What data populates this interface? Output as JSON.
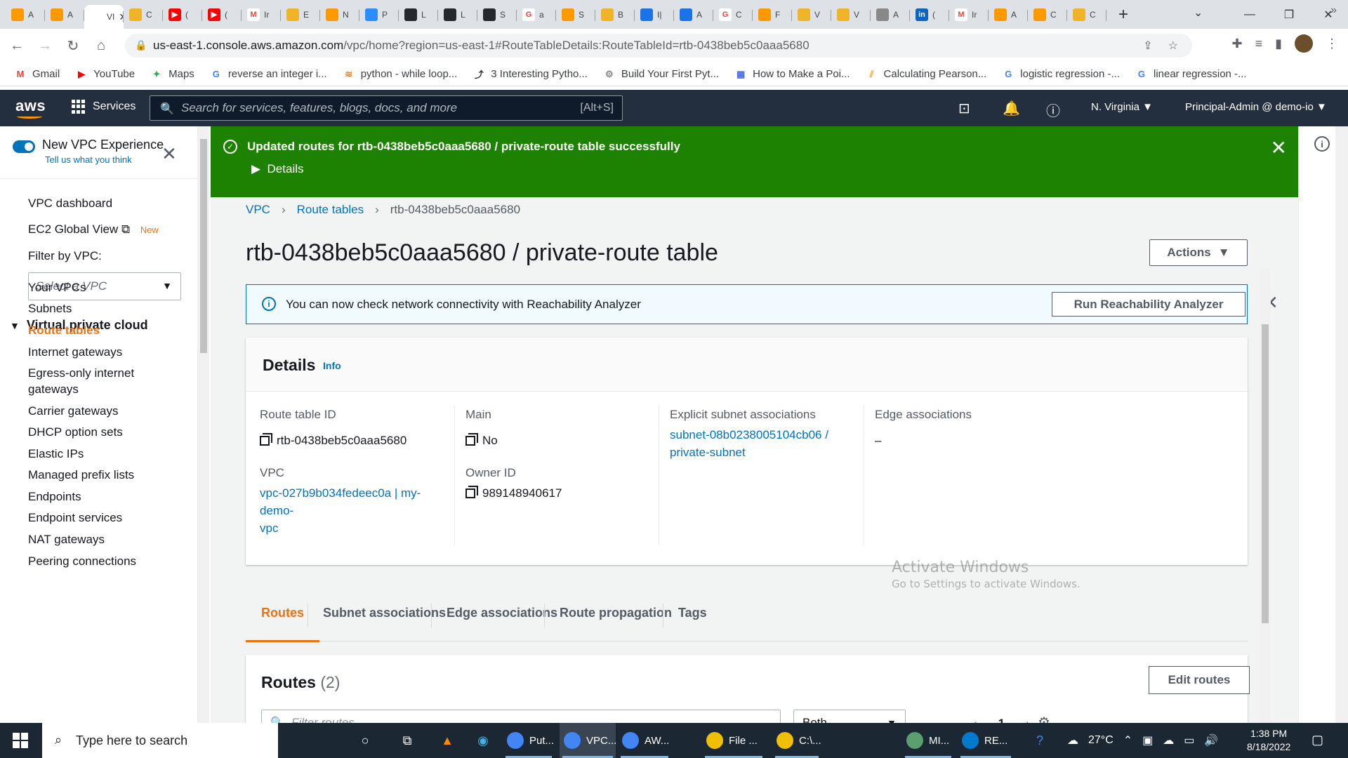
{
  "browser": {
    "tabs": [
      {
        "label": "A",
        "color": "#ff9900",
        "glyph": ""
      },
      {
        "label": "A",
        "color": "#ff9900",
        "glyph": ""
      },
      {
        "label": "VI",
        "color": "#ffffff",
        "glyph": "",
        "active": true
      },
      {
        "label": "C",
        "color": "#f0b429",
        "glyph": ""
      },
      {
        "label": "(",
        "color": "#ff0000",
        "glyph": "▶"
      },
      {
        "label": "(",
        "color": "#ff0000",
        "glyph": "▶"
      },
      {
        "label": "Ir",
        "color": "#ffffff",
        "glyph": "M"
      },
      {
        "label": "E",
        "color": "#f0b429",
        "glyph": ""
      },
      {
        "label": "N",
        "color": "#ff9900",
        "glyph": ""
      },
      {
        "label": "P",
        "color": "#2d8cff",
        "glyph": ""
      },
      {
        "label": "L",
        "color": "#24292e",
        "glyph": ""
      },
      {
        "label": "L",
        "color": "#24292e",
        "glyph": ""
      },
      {
        "label": "S",
        "color": "#24292e",
        "glyph": ""
      },
      {
        "label": "a",
        "color": "#ffffff",
        "glyph": "G"
      },
      {
        "label": "S",
        "color": "#ff9900",
        "glyph": ""
      },
      {
        "label": "B",
        "color": "#f0b429",
        "glyph": ""
      },
      {
        "label": "I|",
        "color": "#1a73e8",
        "glyph": ""
      },
      {
        "label": "A",
        "color": "#1a73e8",
        "glyph": ""
      },
      {
        "label": "C",
        "color": "#ffffff",
        "glyph": "G"
      },
      {
        "label": "F",
        "color": "#ff9900",
        "glyph": ""
      },
      {
        "label": "V",
        "color": "#f0b429",
        "glyph": ""
      },
      {
        "label": "V",
        "color": "#f0b429",
        "glyph": ""
      },
      {
        "label": "A",
        "color": "#888888",
        "glyph": ""
      },
      {
        "label": "(",
        "color": "#0a66c2",
        "glyph": "in"
      },
      {
        "label": "Ir",
        "color": "#ffffff",
        "glyph": "M"
      },
      {
        "label": "A",
        "color": "#ff9900",
        "glyph": ""
      },
      {
        "label": "C",
        "color": "#ff9900",
        "glyph": ""
      },
      {
        "label": "C",
        "color": "#f0b429",
        "glyph": ""
      }
    ],
    "url_host": "us-east-1.console.aws.amazon.com",
    "url_rest": "/vpc/home?region=us-east-1#RouteTableDetails:RouteTableId=rtb-0438beb5c0aaa5680",
    "bookmarks": [
      {
        "label": "Gmail",
        "icon": "M",
        "color": "#ea4335"
      },
      {
        "label": "YouTube",
        "icon": "▶",
        "color": "#ff0000"
      },
      {
        "label": "Maps",
        "icon": "✦",
        "color": "#34a853"
      },
      {
        "label": "reverse an integer i...",
        "icon": "G",
        "color": "#4285f4"
      },
      {
        "label": "python - while loop...",
        "icon": "≋",
        "color": "#f48024"
      },
      {
        "label": "3 Interesting Pytho...",
        "icon": "⤴",
        "color": "#333333"
      },
      {
        "label": "Build Your First Pyt...",
        "icon": "⚙",
        "color": "#888888"
      },
      {
        "label": "How to Make a Poi...",
        "icon": "▦",
        "color": "#4a6ee0"
      },
      {
        "label": "Calculating Pearson...",
        "icon": "⫽",
        "color": "#f5a623"
      },
      {
        "label": "logistic regression -...",
        "icon": "G",
        "color": "#4285f4"
      },
      {
        "label": "linear regression -...",
        "icon": "G",
        "color": "#4285f4"
      }
    ]
  },
  "aws_nav": {
    "logo": "aws",
    "services": "Services",
    "search_placeholder": "Search for services, features, blogs, docs, and more",
    "search_shortcut": "[Alt+S]",
    "region": "N. Virginia ▼",
    "account": "Principal-Admin @ demo-io ▼"
  },
  "sidebar": {
    "new_vpc_experience": "New VPC Experience",
    "tell_us": "Tell us what you think",
    "vpc_dashboard": "VPC dashboard",
    "ec2_global_view": "EC2 Global View",
    "new_badge": "New",
    "filter_by_vpc": "Filter by VPC:",
    "select_vpc_placeholder": "Select a VPC",
    "group_title": "Virtual private cloud",
    "items": [
      "Your VPCs",
      "Subnets",
      "Route tables",
      "Internet gateways",
      "Egress-only internet",
      "gateways",
      "Carrier gateways",
      "DHCP option sets",
      "Elastic IPs",
      "Managed prefix lists",
      "Endpoints",
      "Endpoint services",
      "NAT gateways",
      "Peering connections"
    ],
    "active_item": "Route tables"
  },
  "flash": {
    "message": "Updated routes for rtb-0438beb5c0aaa5680 / private-route table successfully",
    "details": "Details"
  },
  "breadcrumb": {
    "vpc": "VPC",
    "route_tables": "Route tables",
    "current": "rtb-0438beb5c0aaa5680"
  },
  "page": {
    "title": "rtb-0438beb5c0aaa5680 / private-route table",
    "actions": "Actions"
  },
  "info_banner": {
    "text": "You can now check network connectivity with Reachability Analyzer",
    "button": "Run Reachability Analyzer"
  },
  "details": {
    "title": "Details",
    "info": "Info",
    "route_table_id_label": "Route table ID",
    "route_table_id": "rtb-0438beb5c0aaa5680",
    "vpc_label": "VPC",
    "vpc_value_line1": "vpc-027b9b034fedeec0a | my-demo-",
    "vpc_value_line2": "vpc",
    "main_label": "Main",
    "main_value": "No",
    "owner_label": "Owner ID",
    "owner_value": "989148940617",
    "explicit_label": "Explicit subnet associations",
    "explicit_line1": "subnet-08b0238005104cb06 /",
    "explicit_line2": "private-subnet",
    "edge_label": "Edge associations",
    "edge_value": "–"
  },
  "tabs": [
    "Routes",
    "Subnet associations",
    "Edge associations",
    "Route propagation",
    "Tags"
  ],
  "routes": {
    "title": "Routes",
    "count": "(2)",
    "edit_button": "Edit routes",
    "filter_placeholder": "Filter routes",
    "select_value": "Both",
    "page_number": "1"
  },
  "watermark": {
    "line1": "Activate Windows",
    "line2": "Go to Settings to activate Windows."
  },
  "taskbar": {
    "search_placeholder": "Type here to search",
    "apps": [
      {
        "label": "Put...",
        "color": "#4285f4"
      },
      {
        "label": "VPC...",
        "color": "#4285f4"
      },
      {
        "label": "AW...",
        "color": "#4285f4"
      },
      {
        "label": "File ...",
        "color": "#f0c000"
      },
      {
        "label": "C:\\...",
        "color": "#f0c000"
      },
      {
        "label": "MI...",
        "color": "#5a9e6f"
      },
      {
        "label": "RE...",
        "color": "#007acc"
      }
    ],
    "temperature": "27°C",
    "time": "1:38 PM",
    "date": "8/18/2022"
  }
}
